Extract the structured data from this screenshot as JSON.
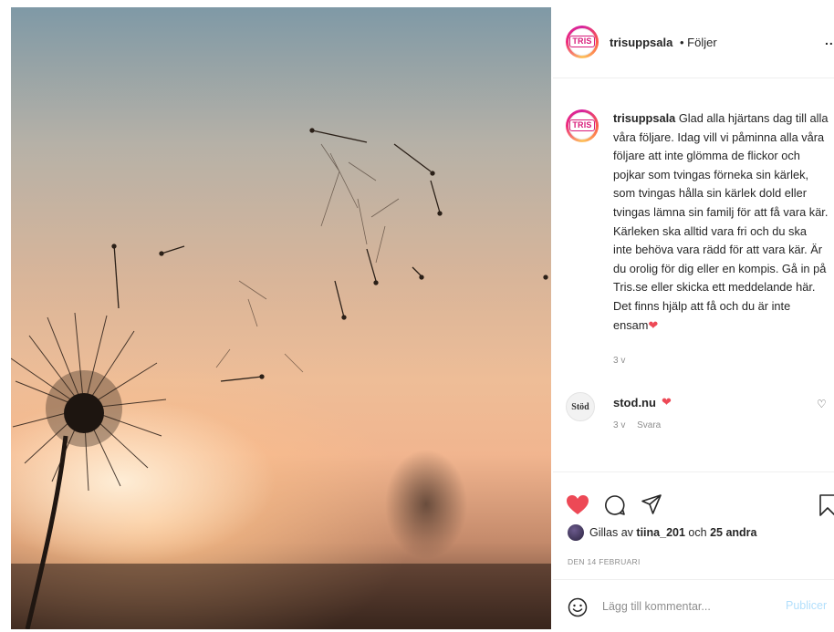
{
  "post": {
    "username": "trisuppsala",
    "follow_label": "• Följer",
    "more_label": "...",
    "avatar_logo_text": "TRIS",
    "caption_username": "trisuppsala",
    "caption_text": "Glad alla hjärtans dag till alla våra följare. Idag vill vi påminna alla våra följare att inte glömma de flickor och pojkar som tvingas förneka sin kärlek, som tvingas hålla sin kärlek dold eller tvingas lämna sin familj för att få vara kär. Kärleken ska alltid vara fri och du ska inte behöva vara rädd för att vara kär. Är du orolig för dig eller en kompis. Gå in på Tris.se eller skicka ett meddelande här. Det finns hjälp att få och du är inte ensam",
    "caption_heart": "❤",
    "caption_time": "3 v"
  },
  "comment": {
    "avatar_text": "Stöd",
    "username": "stod.nu",
    "heart": "❤",
    "like_icon": "♡",
    "time": "3 v",
    "reply_label": "Svara"
  },
  "likes": {
    "prefix": "Gillas av ",
    "user": "tiina_201",
    "middle": " och ",
    "others": "25 andra"
  },
  "date_label": "DEN 14 FEBRUARI",
  "add_comment": {
    "placeholder": "Lägg till kommentar...",
    "publish_label": "Publicer"
  },
  "colors": {
    "like_red": "#ed4956",
    "brand_pink": "#d81b7a",
    "publish_disabled": "#b2dffc"
  }
}
